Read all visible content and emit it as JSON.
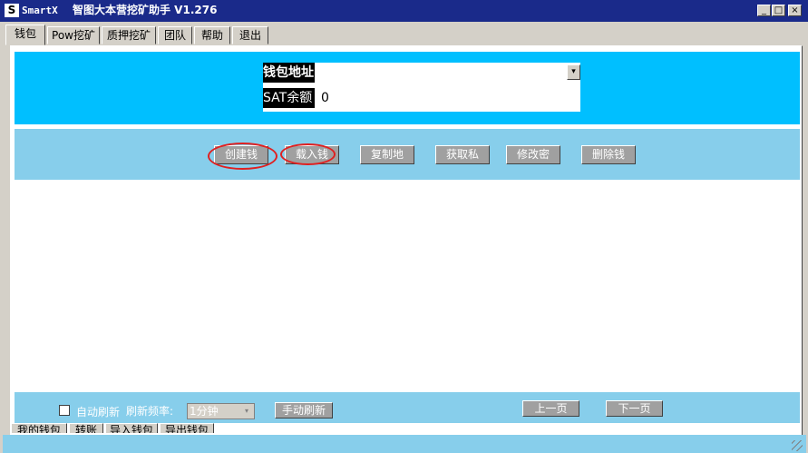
{
  "window": {
    "logo_glyph": "S",
    "brand": "SmartX",
    "title": "智图大本营挖矿助手  V1.276",
    "minimize_glyph": "_",
    "maximize_glyph": "□",
    "close_glyph": "×"
  },
  "tabs": [
    {
      "label": "钱包"
    },
    {
      "label": "Pow挖矿"
    },
    {
      "label": "质押挖矿"
    },
    {
      "label": "团队"
    },
    {
      "label": "帮助"
    },
    {
      "label": "退出"
    }
  ],
  "wallet": {
    "address_label": "钱包地址",
    "address_value": "",
    "dropdown_glyph": "▾",
    "balance_label": "SAT余额",
    "balance_value": "0"
  },
  "actions": [
    {
      "label": "创建钱"
    },
    {
      "label": "载入钱"
    },
    {
      "label": "复制地"
    },
    {
      "label": "获取私"
    },
    {
      "label": "修改密"
    },
    {
      "label": "删除钱"
    }
  ],
  "footer": {
    "auto_refresh_label": "自动刷新",
    "interval_label": "刷新频率:",
    "interval_value": "1分钟",
    "select_glyph": "▾",
    "manual_refresh_label": "手动刷新",
    "prev_label": "上一页",
    "next_label": "下一页"
  },
  "bottom_tabs": [
    {
      "label": "我的钱包"
    },
    {
      "label": "转账"
    },
    {
      "label": "导入钱包"
    },
    {
      "label": "导出钱包"
    }
  ],
  "colors": {
    "titlebar": "#1a2a8a",
    "top_band": "#00bfff",
    "button_band": "#87ceeb",
    "highlight_ring": "#e02020"
  }
}
